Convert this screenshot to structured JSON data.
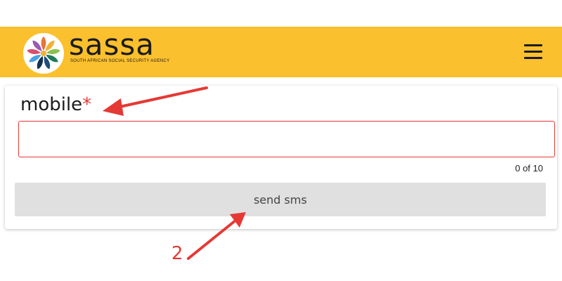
{
  "header": {
    "brand_name": "sassa",
    "brand_tagline": "SOUTH AFRICAN SOCIAL SECURITY AGENCY",
    "logo_icon": "sassa-logo-icon",
    "menu_icon": "hamburger-menu-icon",
    "background_color": "#fbc02d"
  },
  "form": {
    "mobile_label": "mobile",
    "required_marker": "*",
    "mobile_value": "",
    "mobile_placeholder": "",
    "counter": "0 of 10",
    "send_button_label": "send sms"
  },
  "annotations": {
    "step_number": "2",
    "arrow_color": "#e53935"
  }
}
